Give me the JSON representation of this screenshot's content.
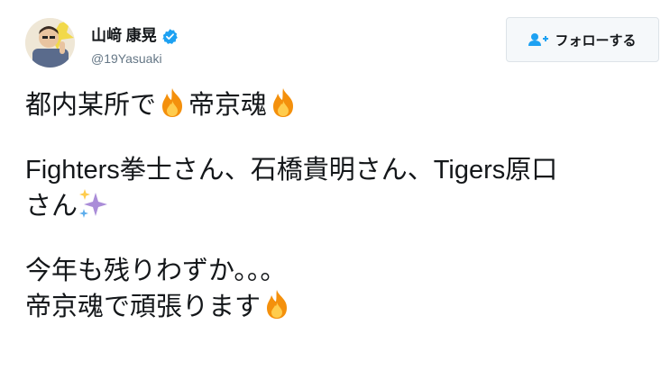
{
  "user": {
    "display_name": "山﨑 康晃",
    "username": "@19Yasuaki",
    "verified": true
  },
  "follow_button": {
    "label": "フォローする",
    "icon": "add-user-icon"
  },
  "tweet": {
    "line1_a": "都内某所で",
    "line1_b": "帝京魂",
    "line2": "Fighters拳士さん、石橋貴明さん、Tigers原口",
    "line3": "さん",
    "line4": "今年も残りわずか。。。",
    "line5": "帝京魂で頑張ります",
    "emojis": [
      "fire-emoji",
      "sparkles-emoji"
    ]
  },
  "colors": {
    "verified": "#1da1f2",
    "accent": "#1da1f2",
    "text": "#14171a",
    "muted": "#657786"
  }
}
